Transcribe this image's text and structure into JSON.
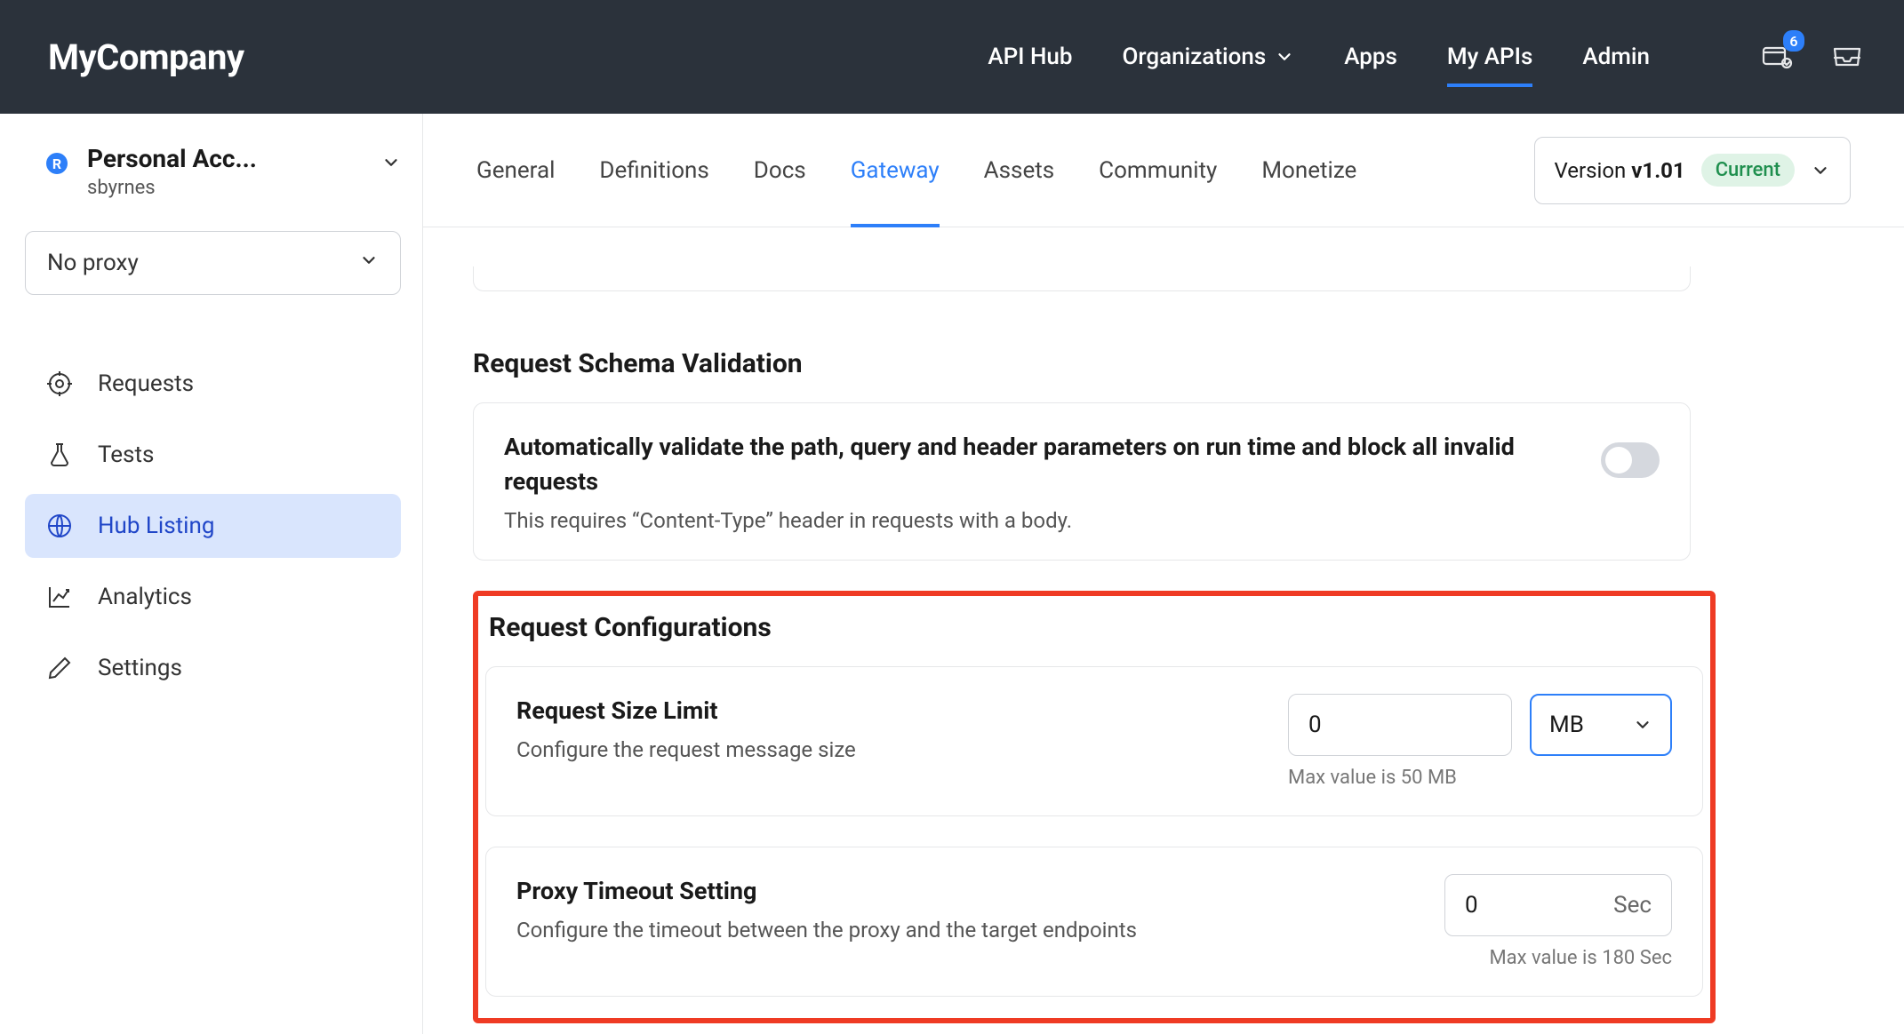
{
  "header": {
    "brand": "MyCompany",
    "nav": {
      "api_hub": "API Hub",
      "organizations": "Organizations",
      "apps": "Apps",
      "my_apis": "My APIs",
      "admin": "Admin"
    },
    "notification_count": "6"
  },
  "sidebar": {
    "account_title": "Personal Acc...",
    "account_user": "sbyrnes",
    "proxy_label": "No proxy",
    "items": {
      "requests": "Requests",
      "tests": "Tests",
      "hub_listing": "Hub Listing",
      "analytics": "Analytics",
      "settings": "Settings"
    }
  },
  "tabs": {
    "general": "General",
    "definitions": "Definitions",
    "docs": "Docs",
    "gateway": "Gateway",
    "assets": "Assets",
    "community": "Community",
    "monetize": "Monetize"
  },
  "version": {
    "prefix": "Version ",
    "value": "v1.01",
    "badge": "Current"
  },
  "sections": {
    "schema_validation": {
      "title": "Request Schema Validation",
      "card_title": "Automatically validate the path, query and header parameters on run time and block all invalid requests",
      "card_sub": "This requires “Content-Type” header in requests with a body."
    },
    "request_config": {
      "title": "Request Configurations",
      "size_limit": {
        "title": "Request Size Limit",
        "sub": "Configure the request message size",
        "value": "0",
        "unit": "MB",
        "hint": "Max value is 50 MB"
      },
      "timeout": {
        "title": "Proxy Timeout Setting",
        "sub": "Configure the timeout between the proxy and the target endpoints",
        "value": "0",
        "unit": "Sec",
        "hint": "Max value is 180 Sec"
      }
    }
  }
}
